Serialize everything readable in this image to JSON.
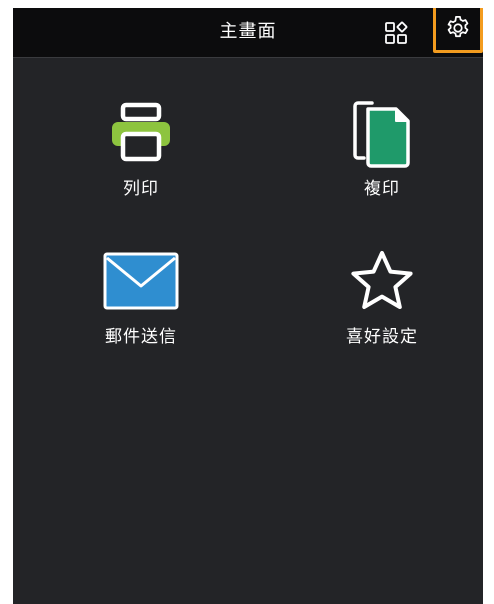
{
  "header": {
    "title": "主畫面"
  },
  "tiles": [
    {
      "label": "列印",
      "icon": "printer-icon"
    },
    {
      "label": "複印",
      "icon": "copy-icon"
    },
    {
      "label": "郵件送信",
      "icon": "mail-icon"
    },
    {
      "label": "喜好設定",
      "icon": "star-icon"
    }
  ],
  "colors": {
    "background": "#232427",
    "header": "#0c0c0d",
    "highlight": "#f39c1f",
    "printer_green": "#8dc43f",
    "copy_green": "#1f9a6a",
    "mail_blue": "#2f8ed0"
  }
}
